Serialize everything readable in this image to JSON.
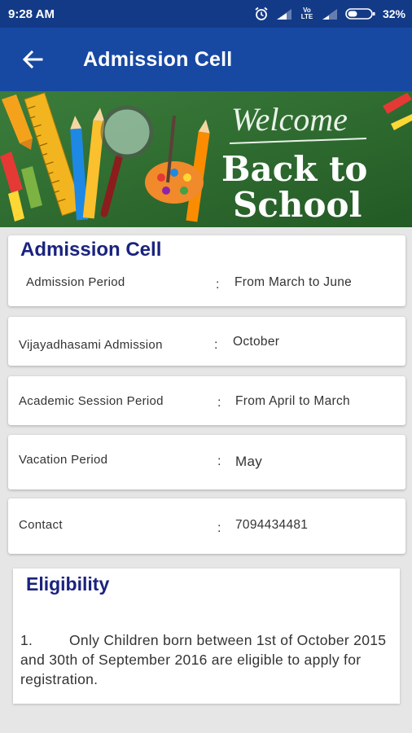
{
  "status_bar": {
    "time": "9:28 AM",
    "battery": "32%",
    "network_1": "Vo LTE"
  },
  "app_bar": {
    "title": "Admission Cell"
  },
  "banner": {
    "welcome": "Welcome",
    "line1": "Back to",
    "line2": "School"
  },
  "admission": {
    "heading": "Admission Cell",
    "rows": [
      {
        "label": "Admission Period",
        "value": "From March to June"
      },
      {
        "label": "Vijayadhasami  Admission",
        "value": "October"
      },
      {
        "label": "Academic Session Period",
        "value": "From April to March"
      },
      {
        "label": "Vacation Period",
        "value": "May"
      },
      {
        "label": "Contact",
        "value": "7094434481"
      }
    ],
    "separator": ":"
  },
  "eligibility": {
    "title": "Eligibility",
    "item_number": "1.",
    "item_text": "Only Children born between 1st of October 2015 and 30th of September 2016 are eligible to apply for registration."
  },
  "colors": {
    "status_bar": "#133a87",
    "app_bar": "#1749a3",
    "heading": "#1a237e",
    "banner_bg": "#2f6b2f"
  }
}
